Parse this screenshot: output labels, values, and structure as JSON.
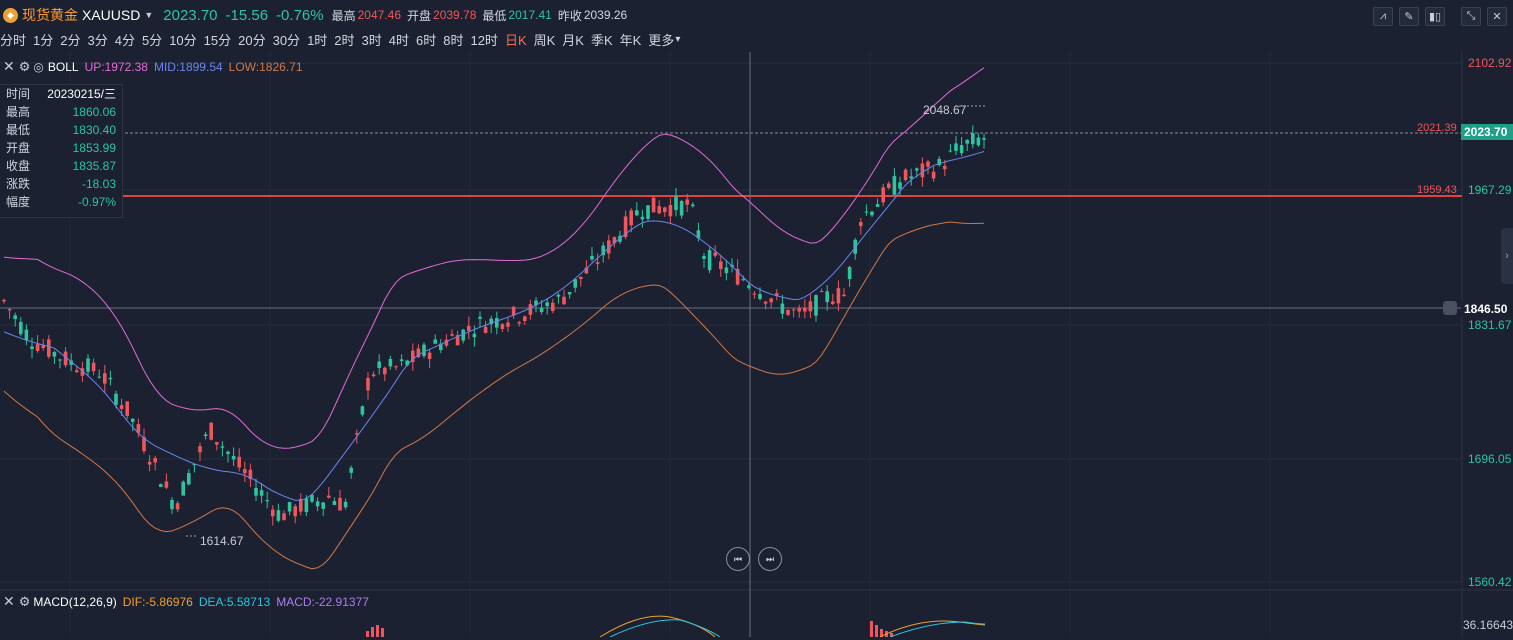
{
  "header": {
    "name": "现货黄金",
    "code": "XAUUSD",
    "price": "2023.70",
    "change": "-15.56",
    "change_pct": "-0.76%",
    "high_label": "最高",
    "high": "2047.46",
    "open_label": "开盘",
    "open": "2039.78",
    "low_label": "最低",
    "low": "2017.41",
    "prev_label": "昨收",
    "prev": "2039.26"
  },
  "periods": [
    "分时",
    "1分",
    "2分",
    "3分",
    "4分",
    "5分",
    "10分",
    "15分",
    "20分",
    "30分",
    "1时",
    "2时",
    "3时",
    "4时",
    "6时",
    "8时",
    "12时",
    "日K",
    "周K",
    "月K",
    "季K",
    "年K",
    "更多"
  ],
  "active_period": "日K",
  "boll": {
    "name": "BOLL",
    "up": "UP:1972.38",
    "mid": "MID:1899.54",
    "low": "LOW:1826.71",
    "up_color": "#e36bd6",
    "mid_color": "#6b86f0",
    "low_color": "#d0784a"
  },
  "tooltip": [
    {
      "label": "时间",
      "value": "20230215/三"
    },
    {
      "label": "最高",
      "value": "1860.06"
    },
    {
      "label": "最低",
      "value": "1830.40"
    },
    {
      "label": "开盘",
      "value": "1853.99"
    },
    {
      "label": "收盘",
      "value": "1835.87"
    },
    {
      "label": "涨跌",
      "value": "-18.03"
    },
    {
      "label": "幅度",
      "value": "-0.97%"
    }
  ],
  "axis": {
    "labels": [
      "2102.92",
      "1967.29",
      "1831.67",
      "1696.05",
      "1560.42"
    ],
    "current": "2023.70",
    "crosshair": "1846.50",
    "line_2021": "2021.39",
    "line_1959": "1959.43",
    "max_marker": "2048.67",
    "min_marker": "1614.67",
    "macd_axis": "36.16643"
  },
  "macd": {
    "name": "MACD(12,26,9)",
    "dif": "DIF:-5.86976",
    "dea": "DEA:5.58713",
    "macd": "MACD:-22.91377",
    "dif_color": "#f0a030",
    "dea_color": "#2ec4e0",
    "macd_color": "#b07cf0"
  },
  "colors": {
    "up": "#f0565e",
    "down": "#2ec4a0",
    "bg": "#1b2130"
  },
  "icons": [
    "settings-icon",
    "pen-icon",
    "candle-type-icon",
    "shrink-icon",
    "close-icon"
  ]
}
